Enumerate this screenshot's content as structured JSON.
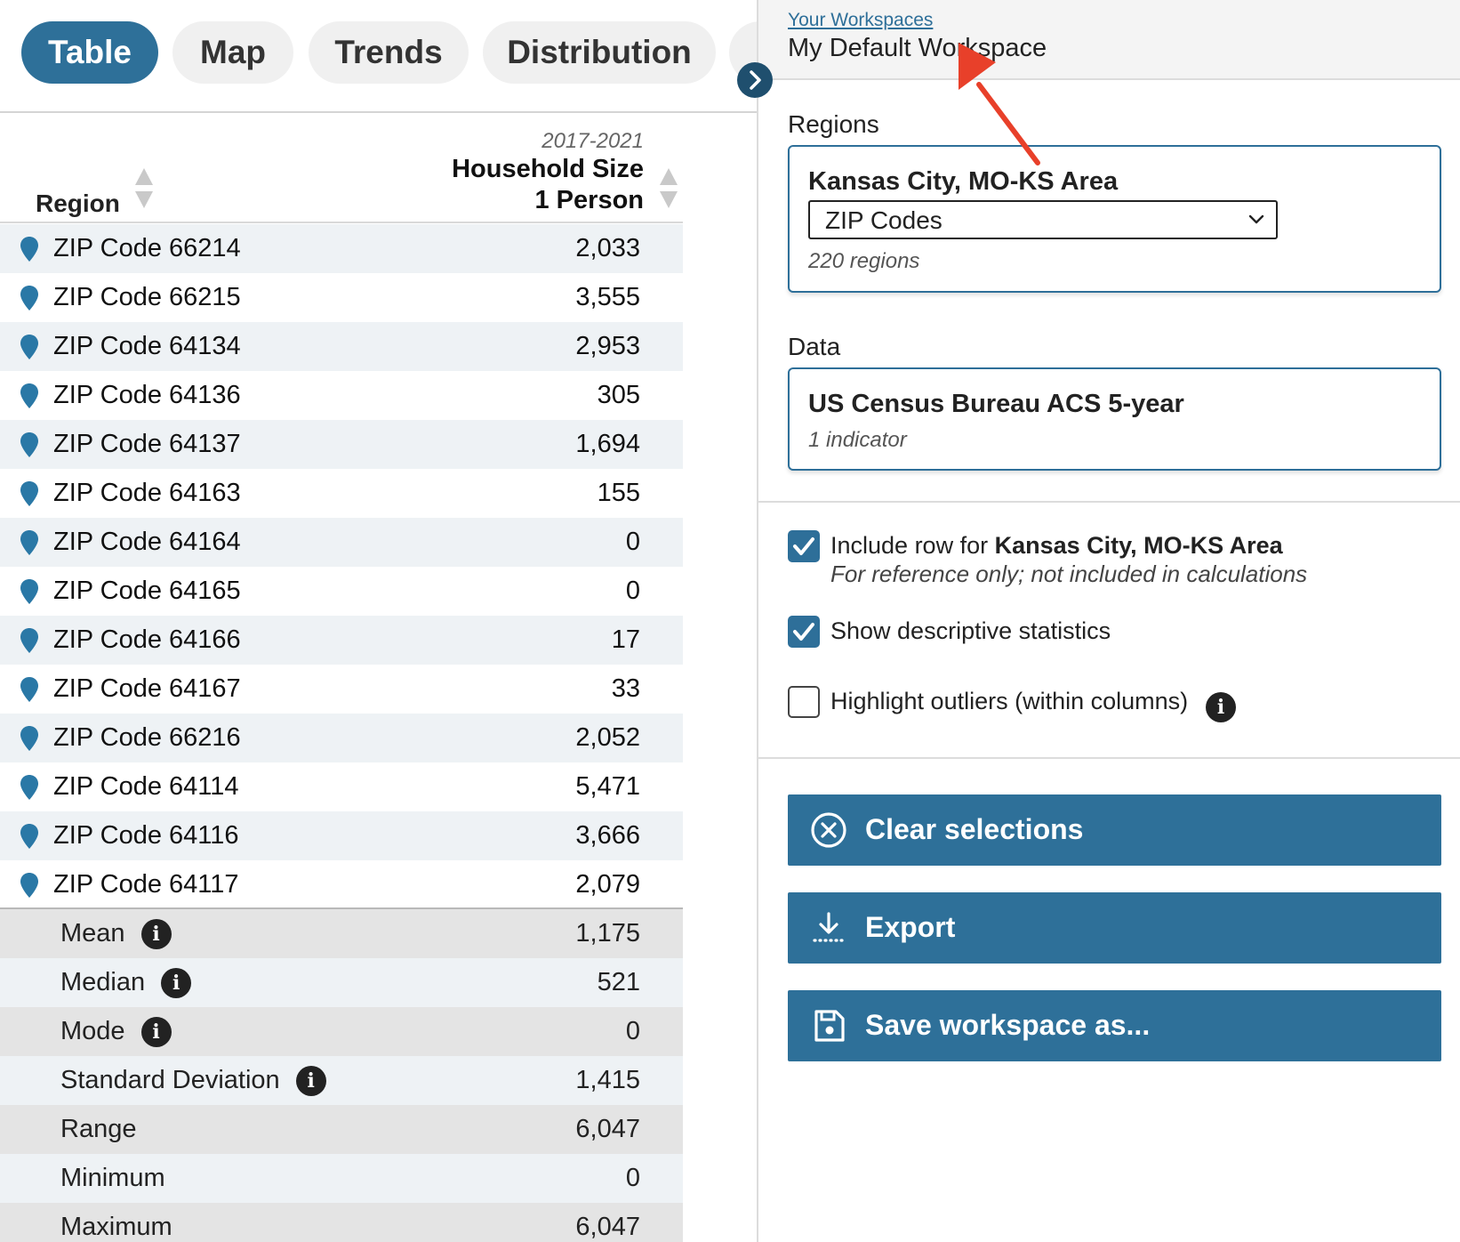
{
  "tabs": [
    {
      "label": "Table",
      "active": true
    },
    {
      "label": "Map",
      "active": false
    },
    {
      "label": "Trends",
      "active": false
    },
    {
      "label": "Distribution",
      "active": false
    }
  ],
  "table": {
    "region_header": "Region",
    "year_range": "2017-2021",
    "indicator_title": "Household Size",
    "indicator_subtitle": "1 Person",
    "rows": [
      {
        "name": "ZIP Code 66214",
        "value": "2,033"
      },
      {
        "name": "ZIP Code 66215",
        "value": "3,555"
      },
      {
        "name": "ZIP Code 64134",
        "value": "2,953"
      },
      {
        "name": "ZIP Code 64136",
        "value": "305"
      },
      {
        "name": "ZIP Code 64137",
        "value": "1,694"
      },
      {
        "name": "ZIP Code 64163",
        "value": "155"
      },
      {
        "name": "ZIP Code 64164",
        "value": "0"
      },
      {
        "name": "ZIP Code 64165",
        "value": "0"
      },
      {
        "name": "ZIP Code 64166",
        "value": "17"
      },
      {
        "name": "ZIP Code 64167",
        "value": "33"
      },
      {
        "name": "ZIP Code 66216",
        "value": "2,052"
      },
      {
        "name": "ZIP Code 64114",
        "value": "5,471"
      },
      {
        "name": "ZIP Code 64116",
        "value": "3,666"
      },
      {
        "name": "ZIP Code 64117",
        "value": "2,079"
      }
    ],
    "stats": [
      {
        "name": "Mean",
        "value": "1,175",
        "info": true
      },
      {
        "name": "Median",
        "value": "521",
        "info": true
      },
      {
        "name": "Mode",
        "value": "0",
        "info": true
      },
      {
        "name": "Standard Deviation",
        "value": "1,415",
        "info": true
      },
      {
        "name": "Range",
        "value": "6,047",
        "info": false
      },
      {
        "name": "Minimum",
        "value": "0",
        "info": false
      },
      {
        "name": "Maximum",
        "value": "6,047",
        "info": false
      }
    ]
  },
  "workspace": {
    "link": "Your Workspaces",
    "name": "My Default Workspace"
  },
  "regions": {
    "label": "Regions",
    "area": "Kansas City, MO-KS Area",
    "select_value": "ZIP Codes",
    "count": "220 regions"
  },
  "data_source": {
    "label": "Data",
    "title": "US Census Bureau ACS 5-year",
    "count": "1 indicator"
  },
  "options": {
    "include_row_prefix": "Include row for ",
    "include_row_area": "Kansas City, MO-KS Area",
    "include_row_checked": true,
    "include_row_note": "For reference only; not included in calculations",
    "show_stats_label": "Show descriptive statistics",
    "show_stats_checked": true,
    "highlight_label": "Highlight outliers (within columns)",
    "highlight_checked": false
  },
  "actions": {
    "clear": "Clear selections",
    "export": "Export",
    "save": "Save workspace as..."
  },
  "colors": {
    "accent": "#2e7099",
    "pin": "#2a78a6",
    "annotation_arrow": "#e8402a"
  },
  "icons": {
    "pin": "map-pin-icon",
    "toggle": "chevron-right-icon",
    "clear": "circle-x-icon",
    "export": "download-icon",
    "save": "floppy-disk-icon",
    "info": "info-icon",
    "check": "checkmark-icon"
  }
}
